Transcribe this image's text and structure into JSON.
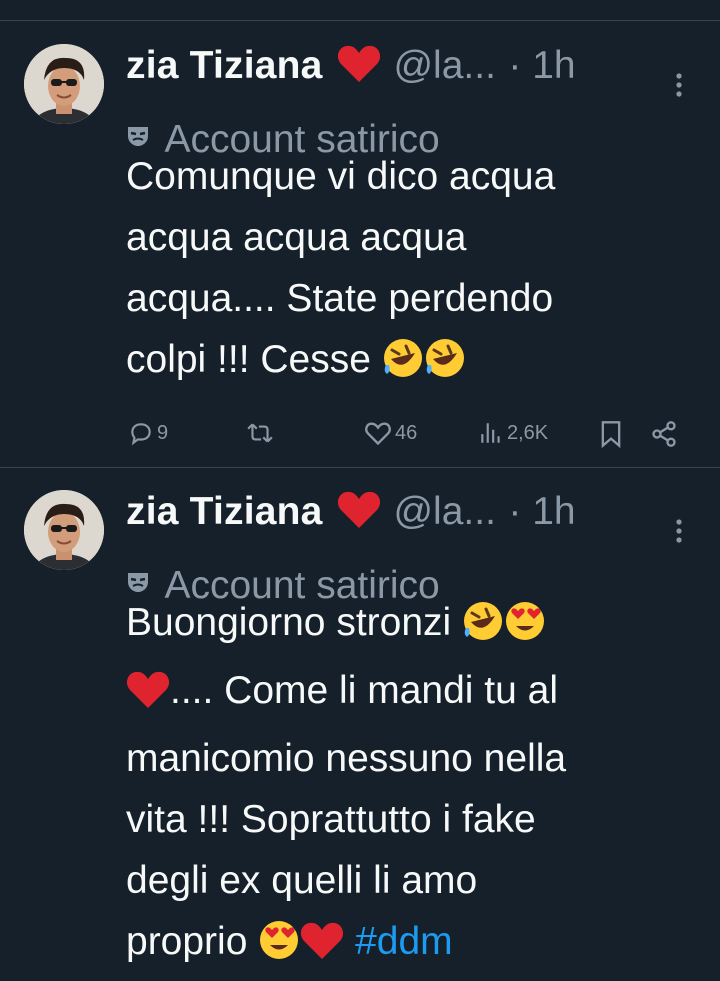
{
  "tweets": [
    {
      "author": {
        "name": "zia Tiziana",
        "handle": "@la...",
        "time": "· 1h"
      },
      "badge": "Account satirico",
      "lines": [
        "Comunque vi dico acqua",
        "acqua acqua acqua",
        "acqua.... State perdendo",
        "colpi !!! Cesse"
      ],
      "actions": {
        "replies": "9",
        "retweets": "",
        "likes": "46",
        "views": "2,6K"
      }
    },
    {
      "author": {
        "name": "zia Tiziana",
        "handle": "@la...",
        "time": "· 1h"
      },
      "badge": "Account satirico",
      "lines": [
        "Buongiorno stronzi",
        ".... Come li mandi tu al",
        "manicomio nessuno nella",
        "vita !!! Soprattutto i fake",
        "degli ex quelli li amo",
        "proprio"
      ],
      "hashtag": "#ddm"
    }
  ],
  "colors": {
    "background": "#15202b",
    "text": "#f7f9f9",
    "secondary": "#8b98a5",
    "link": "#1d9bf0",
    "divider": "#38444d",
    "heart": "#e0242f"
  },
  "icons": [
    "red-heart-emoji",
    "mask-icon",
    "more-options-icon",
    "reply-icon",
    "retweet-icon",
    "like-icon",
    "views-icon",
    "bookmark-icon",
    "share-icon",
    "rofl-emoji",
    "heart-eyes-emoji",
    "avatar"
  ]
}
